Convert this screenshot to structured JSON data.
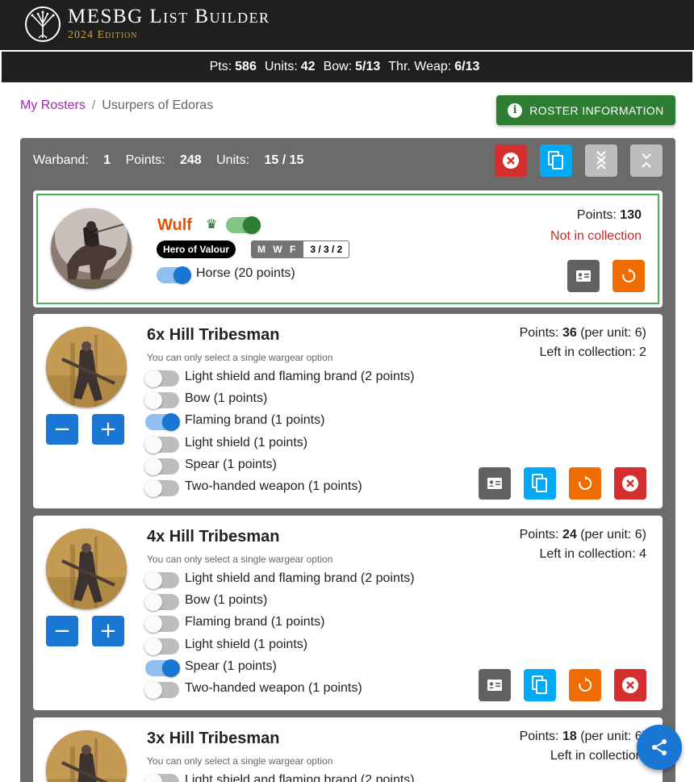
{
  "app": {
    "title": "MESBG List Builder",
    "subtitle": "2024 Edition"
  },
  "stats": {
    "pts_label": "Pts:",
    "pts": "586",
    "units_label": "Units:",
    "units": "42",
    "bow_label": "Bow:",
    "bow": "5/13",
    "thr_label": "Thr. Weap:",
    "thr": "6/13"
  },
  "breadcrumb": {
    "root": "My Rosters",
    "current": "Usurpers of Edoras"
  },
  "roster_info_label": "ROSTER INFORMATION",
  "warband": {
    "warband_label": "Warband:",
    "warband": "1",
    "points_label": "Points:",
    "points": "248",
    "units_label": "Units:",
    "units": "15 / 15"
  },
  "hero": {
    "name": "Wulf",
    "badge": "Hero of Valour",
    "mwf_label": "M W F",
    "mwf": "3 / 3 / 2",
    "option": "Horse (20 points)",
    "points_label": "Points:",
    "points": "130",
    "collection": "Not in collection"
  },
  "units": [
    {
      "title": "6x Hill Tribesman",
      "hint": "You can only select a single wargear option",
      "points_label": "Points:",
      "points": "36",
      "per_unit": "(per unit: 6)",
      "collection_label": "Left in collection:",
      "collection": "2",
      "options": [
        {
          "label": "Light shield and flaming brand (2 points)",
          "on": false
        },
        {
          "label": "Bow (1 points)",
          "on": false
        },
        {
          "label": "Flaming brand (1 points)",
          "on": true
        },
        {
          "label": "Light shield (1 points)",
          "on": false
        },
        {
          "label": "Spear (1 points)",
          "on": false
        },
        {
          "label": "Two-handed weapon (1 points)",
          "on": false
        }
      ]
    },
    {
      "title": "4x Hill Tribesman",
      "hint": "You can only select a single wargear option",
      "points_label": "Points:",
      "points": "24",
      "per_unit": "(per unit: 6)",
      "collection_label": "Left in collection:",
      "collection": "4",
      "options": [
        {
          "label": "Light shield and flaming brand (2 points)",
          "on": false
        },
        {
          "label": "Bow (1 points)",
          "on": false
        },
        {
          "label": "Flaming brand (1 points)",
          "on": false
        },
        {
          "label": "Light shield (1 points)",
          "on": false
        },
        {
          "label": "Spear (1 points)",
          "on": true
        },
        {
          "label": "Two-handed weapon (1 points)",
          "on": false
        }
      ]
    },
    {
      "title": "3x Hill Tribesman",
      "hint": "You can only select a single wargear option",
      "points_label": "Points:",
      "points": "18",
      "per_unit": "(per unit: 6)",
      "collection_label": "Left in collection:",
      "options": [
        {
          "label": "Light shield and flaming brand (2 points)",
          "on": false
        }
      ]
    }
  ],
  "icons": {
    "remove": "close-icon",
    "copy": "copy-icon",
    "expand": "expand-all-icon",
    "collapse": "collapse-all-icon",
    "card": "profile-card-icon",
    "swap": "swap-icon",
    "share": "share-icon",
    "crown": "crown-icon"
  },
  "colors": {
    "header_bg": "#1f1f1f",
    "accent_green": "#2e7d32",
    "hero_name": "#e65100",
    "link": "#9c27b0",
    "warband_bg": "#6b6b6b",
    "primary_blue": "#1976d2"
  }
}
